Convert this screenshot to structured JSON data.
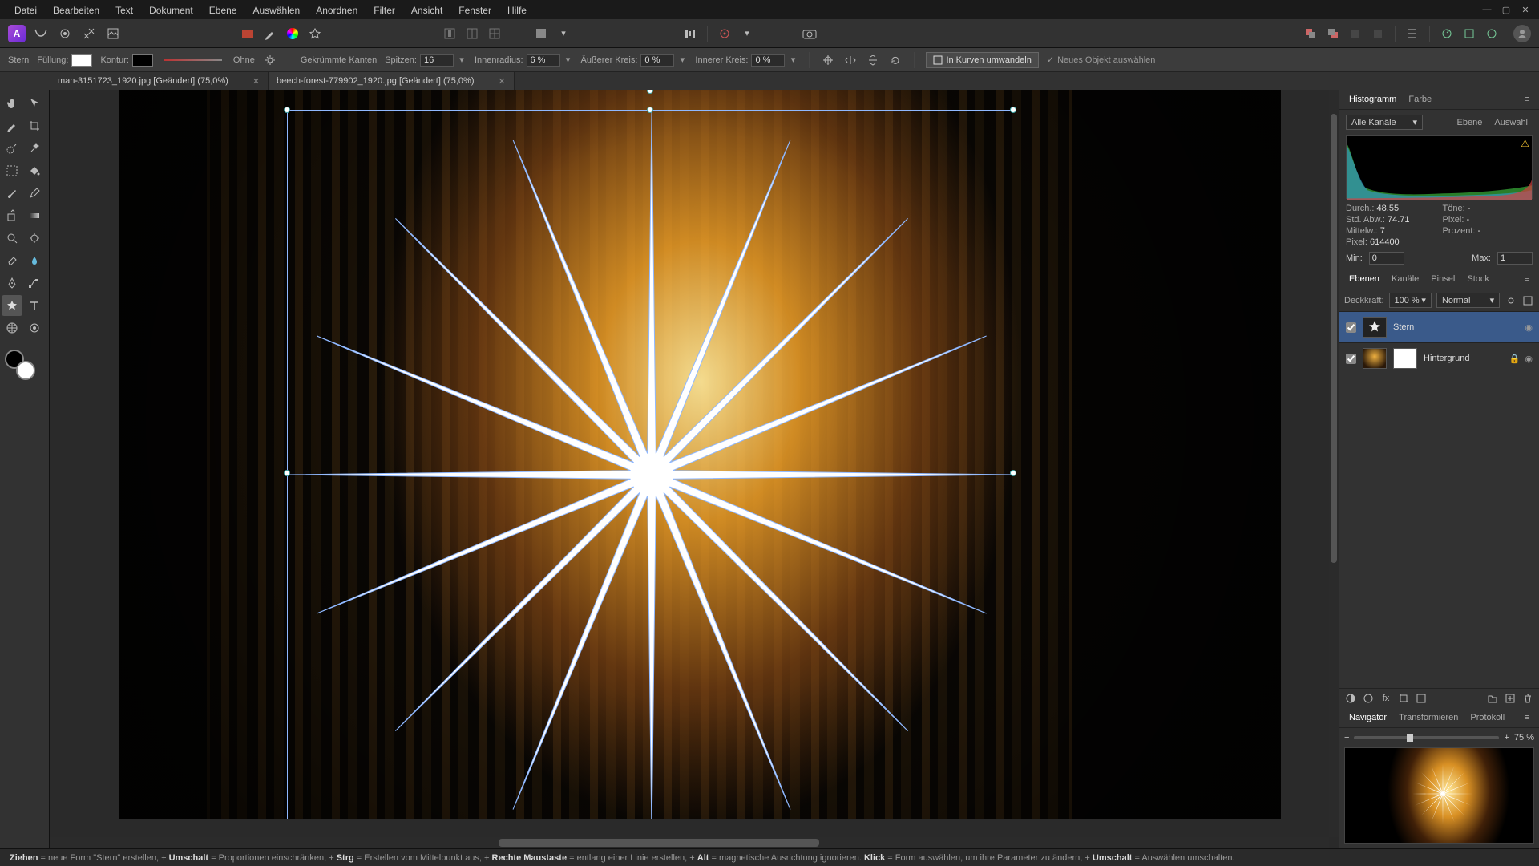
{
  "menu": [
    "Datei",
    "Bearbeiten",
    "Text",
    "Dokument",
    "Ebene",
    "Auswählen",
    "Anordnen",
    "Filter",
    "Ansicht",
    "Fenster",
    "Hilfe"
  ],
  "tabs": [
    {
      "title": "man-3151723_1920.jpg [Geändert] (75,0%)",
      "active": false
    },
    {
      "title": "beech-forest-779902_1920.jpg [Geändert] (75,0%)",
      "active": true
    }
  ],
  "ctx": {
    "tool": "Stern",
    "fill_label": "Füllung:",
    "stroke_label": "Kontur:",
    "stroke_style": "Ohne",
    "curved_label": "Gekrümmte Kanten",
    "points_label": "Spitzen:",
    "points": "16",
    "inner_label": "Innenradius:",
    "inner": "6 %",
    "outerc_label": "Äußerer Kreis:",
    "outerc": "0 %",
    "innerc_label": "Innerer Kreis:",
    "innerc": "0 %",
    "convert": "In Kurven umwandeln",
    "newobj": "Neues Objekt auswählen"
  },
  "histo": {
    "tab1": "Histogramm",
    "tab2": "Farbe",
    "channels": "Alle Kanäle",
    "sub1": "Ebene",
    "sub2": "Auswahl",
    "stats": {
      "durch_l": "Durch.:",
      "durch": "48.55",
      "std_l": "Std. Abw.:",
      "std": "74.71",
      "mitt_l": "Mittelw.:",
      "mitt": "7",
      "pix_l": "Pixel:",
      "pix": "614400",
      "tone_l": "Töne:",
      "tone": "-",
      "pixr_l": "Pixel:",
      "pixr": "-",
      "proz_l": "Prozent:",
      "proz": "-"
    },
    "min_l": "Min:",
    "min": "0",
    "max_l": "Max:",
    "max": "1"
  },
  "layers": {
    "tabs": [
      "Ebenen",
      "Kanäle",
      "Pinsel",
      "Stock"
    ],
    "opacity_l": "Deckkraft:",
    "opacity": "100 %",
    "blend": "Normal",
    "items": [
      {
        "name": "Stern",
        "sel": true
      },
      {
        "name": "Hintergrund",
        "sel": false
      }
    ]
  },
  "nav": {
    "tabs": [
      "Navigator",
      "Transformieren",
      "Protokoll"
    ],
    "zoom": "75 %"
  },
  "status": {
    "parts": [
      {
        "b": "Ziehen",
        "t": " = neue Form \"Stern\" erstellen, +"
      },
      {
        "b": "Umschalt",
        "t": " = Proportionen einschränken, +"
      },
      {
        "b": "Strg",
        "t": " = Erstellen vom Mittelpunkt aus, +"
      },
      {
        "b": "Rechte Maustaste",
        "t": " = entlang einer Linie erstellen, +"
      },
      {
        "b": "Alt",
        "t": " = magnetische Ausrichtung ignorieren. "
      },
      {
        "b": "Klick",
        "t": " = Form auswählen, um ihre Parameter zu ändern, +"
      },
      {
        "b": "Umschalt",
        "t": " = Auswählen umschalten."
      }
    ]
  }
}
